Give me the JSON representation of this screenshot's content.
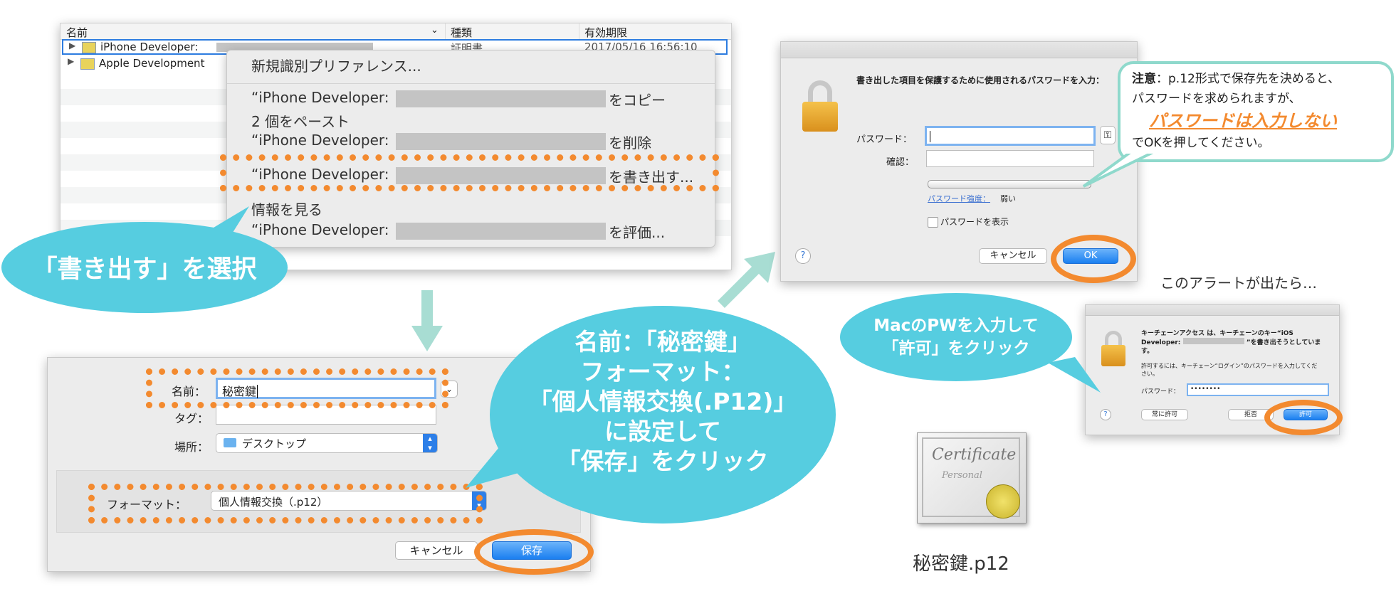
{
  "keychain_list": {
    "col_name": "名前",
    "col_kind": "種類",
    "col_expiry": "有効期限",
    "rows": [
      {
        "name": "iPhone Developer:",
        "kind": "証明書",
        "expiry": "2017/05/16 16:56:10"
      },
      {
        "name": "Apple Development",
        "kind": "",
        "expiry": ""
      }
    ]
  },
  "context_menu": {
    "new_identity_pref": "新規識別プリファレンス...",
    "copy_prefix": "“iPhone Developer:",
    "copy_suffix": "をコピー",
    "paste": "2 個をペースト",
    "delete_prefix": "“iPhone Developer:",
    "delete_suffix": "を削除",
    "export_prefix": "“iPhone Developer:",
    "export_suffix": "を書き出す...",
    "get_info": "情報を見る",
    "evaluate_prefix": "“iPhone Developer:",
    "evaluate_suffix": "を評価..."
  },
  "callout_select_export": "「書き出す」を選択",
  "save_dialog": {
    "name_label": "名前：",
    "name_value": "秘密鍵",
    "tags_label": "タグ：",
    "location_label": "場所：",
    "location_value": "デスクトップ",
    "format_label": "フォーマット：",
    "format_value": "個人情報交換（.p12）",
    "cancel": "キャンセル",
    "save": "保存"
  },
  "callout_save": {
    "line1": "名前：「秘密鍵」",
    "line2": "フォーマット：",
    "line3": "「個人情報交換(.P12)」",
    "line4": "に設定して",
    "line5": "「保存」をクリック"
  },
  "password_dialog": {
    "message": "書き出した項目を保護するために使用されるパスワードを入力：",
    "password_label": "パスワード：",
    "verify_label": "確認：",
    "strength_link": "パスワード強度：",
    "strength_value": "弱い",
    "show_password": "パスワードを表示",
    "cancel": "キャンセル",
    "ok": "OK",
    "help": "?"
  },
  "note_box": {
    "title": "注意",
    "line1_rest": "：p.12形式で保存先を決めると、",
    "line2": "パスワードを求められますが、",
    "emphasis": "パスワードは入力しない",
    "line3": "でOKを押してください。"
  },
  "alert_caption": "このアラートが出たら…",
  "keychain_alert": {
    "message": "キーチェーンアクセス は、キーチェーンのキー“iOS Developer:",
    "message_suffix": "”を書き出そうとしています。",
    "sub": "許可するには、キーチェーン“ログイン”のパスワードを入力してください。",
    "password_label": "パスワード：",
    "password_value": "••••••••",
    "always_allow": "常に許可",
    "deny": "拒否",
    "allow": "許可",
    "help": "?"
  },
  "callout_allow": {
    "line1": "MacのPWを入力して",
    "line2": "「許可」をクリック"
  },
  "certificate_file": {
    "icon_line1": "Certificate",
    "icon_line2": "Personal",
    "filename": "秘密鍵.p12"
  },
  "colors": {
    "accent_orange": "#f38a2f",
    "bubble_cyan": "#56cde0",
    "arrow_mint": "#a8ddd3",
    "note_border": "#8fd9cc",
    "mac_blue": "#1a7ff0"
  }
}
